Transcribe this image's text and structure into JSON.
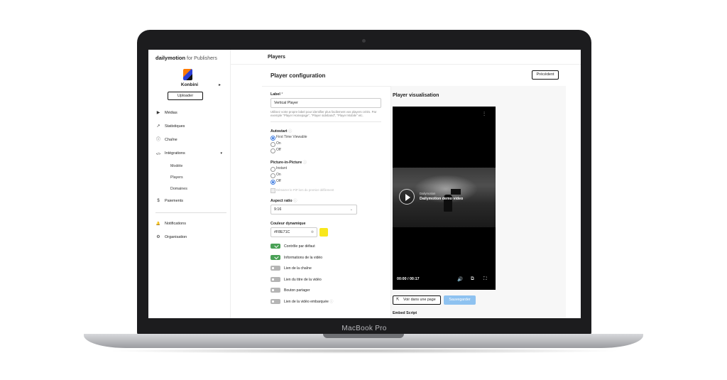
{
  "device": {
    "label": "MacBook Pro"
  },
  "brand": {
    "name": "dailymotion",
    "suffix": "for Publishers"
  },
  "org": {
    "name": "Konbini",
    "chevron": "▸",
    "upload_label": "Uploader"
  },
  "nav": {
    "items": [
      {
        "label": "Médias",
        "icon": "media-icon",
        "glyph": "▶"
      },
      {
        "label": "Statistiques",
        "icon": "trend-icon",
        "glyph": "↗"
      },
      {
        "label": "Chaîne",
        "icon": "channel-icon",
        "glyph": "ⓘ"
      },
      {
        "label": "Intégrations",
        "icon": "code-icon",
        "glyph": "</>",
        "arrow": "▾"
      }
    ],
    "sub_items": [
      "Modèle",
      "Players",
      "Domaines"
    ],
    "payments": {
      "label": "Paiements",
      "icon": "dollar-icon",
      "glyph": "$"
    },
    "notifications": {
      "label": "Notifications",
      "icon": "bell-icon",
      "glyph": "🔔"
    },
    "organisation": {
      "label": "Organisation",
      "icon": "gear-icon",
      "glyph": "⚙"
    }
  },
  "page": {
    "title": "Players",
    "config_title": "Player configuration",
    "prev_label": "Précédent"
  },
  "form": {
    "label": {
      "title": "Label",
      "required": "*",
      "value": "Vertical Player",
      "help": "Utilisez votre propre label pour identifier plus facilement vos players créés. Par exemple \"Player Homepage\", \"Player sideband\", \"Player Mobile\" etc."
    },
    "autostart": {
      "title": "Autostart",
      "options": [
        "First Time Viewable",
        "On",
        "Off"
      ],
      "selected": 0
    },
    "pip": {
      "title": "Picture-in-Picture",
      "options": [
        "Instant",
        "On",
        "Off"
      ],
      "selected": 2,
      "disabled_option": "Démarrer le PiP lors du premier défilement"
    },
    "aspect": {
      "title": "Aspect ratio",
      "value": "9:16",
      "chevron": "⌄"
    },
    "color": {
      "title": "Couleur dynamique",
      "value": "#F8E71C",
      "swatch": "#F8E71C",
      "clear": "⊗"
    },
    "toggles": [
      {
        "label": "Contrôle par défaut",
        "on": true
      },
      {
        "label": "Informations de la vidéo",
        "on": true
      },
      {
        "label": "Lien de la chaîne",
        "on": false
      },
      {
        "label": "Lien du titre de la vidéo",
        "on": false
      },
      {
        "label": "Bouton partager",
        "on": false
      },
      {
        "label": "Lien de la vidéo embarquée",
        "on": false
      }
    ],
    "help_icon": "ⓘ"
  },
  "viz": {
    "title": "Player visualisation",
    "video_brand": "Dailymotion",
    "video_title": "Dailymotion demo video",
    "time": "00:00 / 00:17",
    "settings_glyph": "⫶",
    "volume_glyph": "🔊",
    "pip_glyph": "⧉",
    "fullscreen_glyph": "⛶",
    "open_label": "Voir dans une page",
    "open_glyph": "⇱",
    "save_label": "Sauvegarder",
    "embed_label": "Embed Script"
  }
}
